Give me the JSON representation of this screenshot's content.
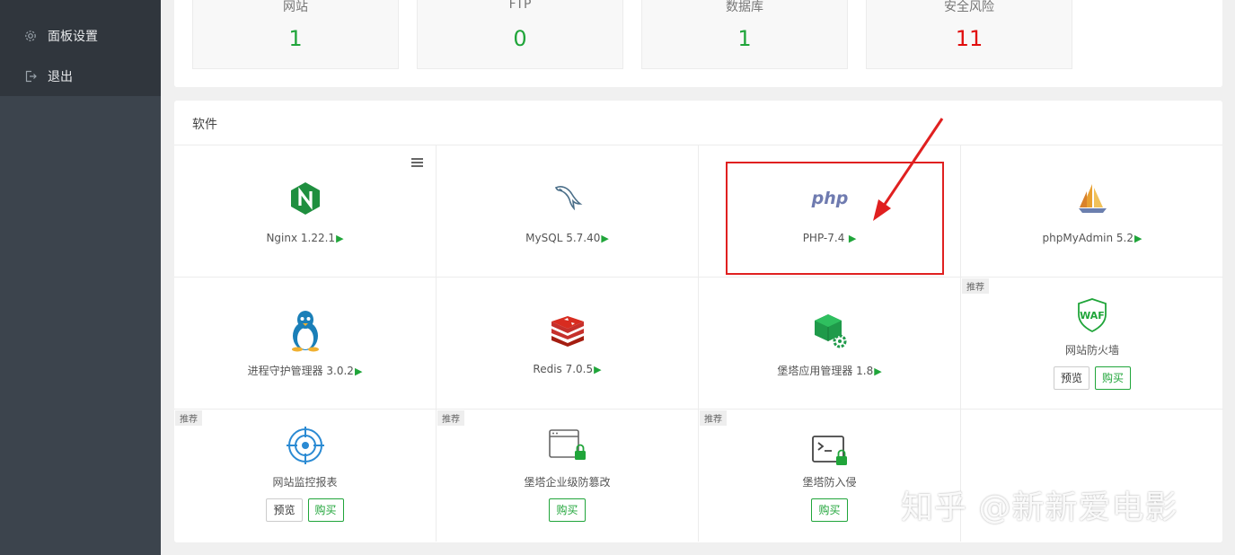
{
  "sidebar": {
    "items": [
      {
        "label": "面板设置",
        "icon": "gear-icon"
      },
      {
        "label": "退出",
        "icon": "logout-icon"
      }
    ]
  },
  "stats": [
    {
      "label": "网站",
      "value": "1",
      "color": "#20a53a"
    },
    {
      "label": "FTP",
      "value": "0",
      "color": "#20a53a"
    },
    {
      "label": "数据库",
      "value": "1",
      "color": "#20a53a"
    },
    {
      "label": "安全风险",
      "value": "11",
      "color": "#e10d0d"
    }
  ],
  "software": {
    "title": "软件",
    "tag_label": "推荐",
    "preview_label": "预览",
    "buy_label": "购买",
    "items": [
      {
        "name": "Nginx 1.22.1",
        "icon": "nginx-icon",
        "playable": true
      },
      {
        "name": "MySQL 5.7.40",
        "icon": "mysql-dolphin-icon",
        "playable": true
      },
      {
        "name": "PHP-7.4",
        "icon": "php-icon",
        "playable": true
      },
      {
        "name": "phpMyAdmin 5.2",
        "icon": "phpmyadmin-sailboat-icon",
        "playable": true
      },
      {
        "name": "进程守护管理器 3.0.2",
        "icon": "linux-penguin-icon",
        "playable": true
      },
      {
        "name": "Redis 7.0.5",
        "icon": "redis-icon",
        "playable": true
      },
      {
        "name": "堡塔应用管理器 1.8",
        "icon": "app-manager-cube-icon",
        "playable": true
      },
      {
        "name": "网站防火墙",
        "icon": "waf-shield-icon",
        "recommended": true
      },
      {
        "name": "网站监控报表",
        "icon": "monitor-target-icon",
        "recommended": true
      },
      {
        "name": "堡塔企业级防篡改",
        "icon": "tamper-lock-window-icon",
        "recommended": true
      },
      {
        "name": "堡塔防入侵",
        "icon": "terminal-lock-icon",
        "recommended": true
      }
    ]
  },
  "watermark": "知乎 @新新爱电影"
}
